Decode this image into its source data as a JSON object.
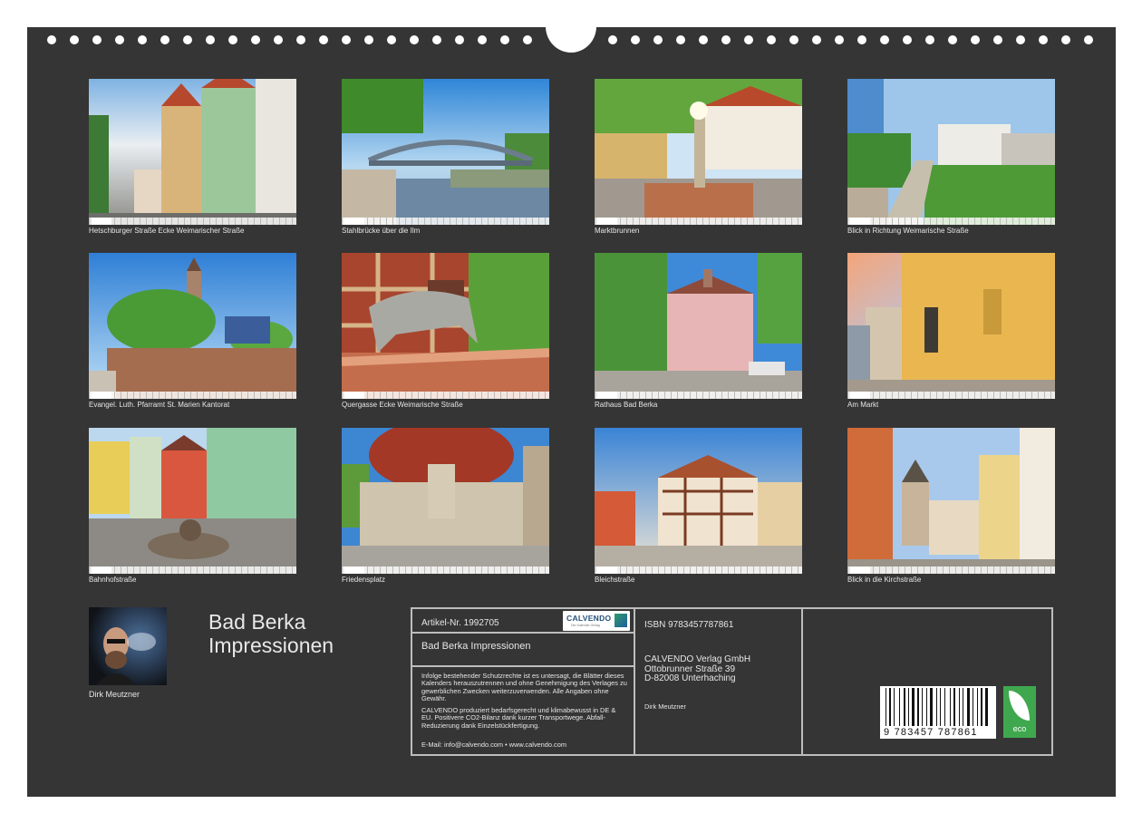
{
  "photos": [
    {
      "caption": "Hetschburger Straße Ecke Weimarischer Straße"
    },
    {
      "caption": "Stahlbrücke über die Ilm"
    },
    {
      "caption": "Marktbrunnen"
    },
    {
      "caption": "Blick in Richtung Weimarische Straße"
    },
    {
      "caption": "Evangel. Luth. Pfarramt St. Marien Kantorat"
    },
    {
      "caption": "Quergasse Ecke Weimarische Straße"
    },
    {
      "caption": "Rathaus Bad Berka"
    },
    {
      "caption": "Am Markt"
    },
    {
      "caption": "Bahnhofstraße"
    },
    {
      "caption": "Friedensplatz"
    },
    {
      "caption": "Bleichstraße"
    },
    {
      "caption": "Blick in die Kirchstraße"
    }
  ],
  "author": {
    "name": "Dirk Meutzner"
  },
  "calendar": {
    "title_line1": "Bad Berka",
    "title_line2": "Impressionen"
  },
  "info": {
    "article": "Artikel-Nr. 1992705",
    "product_title": "Bad Berka Impressionen",
    "legal_text": "Infolge bestehender Schutzrechte ist es untersagt, die Blätter dieses Kalenders herauszutrennen und ohne Genehmigung des Verlages zu gewerblichen Zwecken weiterzuverwenden. Alle Angaben ohne Gewähr.",
    "eco_text": "CALVENDO produziert bedarfsgerecht und klimabewusst in DE & EU. Positivere CO2-Bilanz dank kurzer Transportwege. Abfall-Reduzierung dank Einzelstückfertigung.",
    "contact": "E-Mail: info@calvendo.com • www.calvendo.com",
    "isbn": "ISBN 9783457787861",
    "publisher_line1": "CALVENDO Verlag GmbH",
    "publisher_line2": "Ottobrunner Straße 39",
    "publisher_line3": "D-82008 Unterhaching",
    "author": "Dirk Meutzner",
    "barcode_number": "9  783457  787861",
    "logo_name": "CALVENDO",
    "logo_tagline": "Der Kalender-Verlag",
    "eco_badge": "eco"
  },
  "colors": {
    "sheet": "#353535",
    "frame": "#bdbdbd",
    "eco_green": "#3fa84f"
  }
}
